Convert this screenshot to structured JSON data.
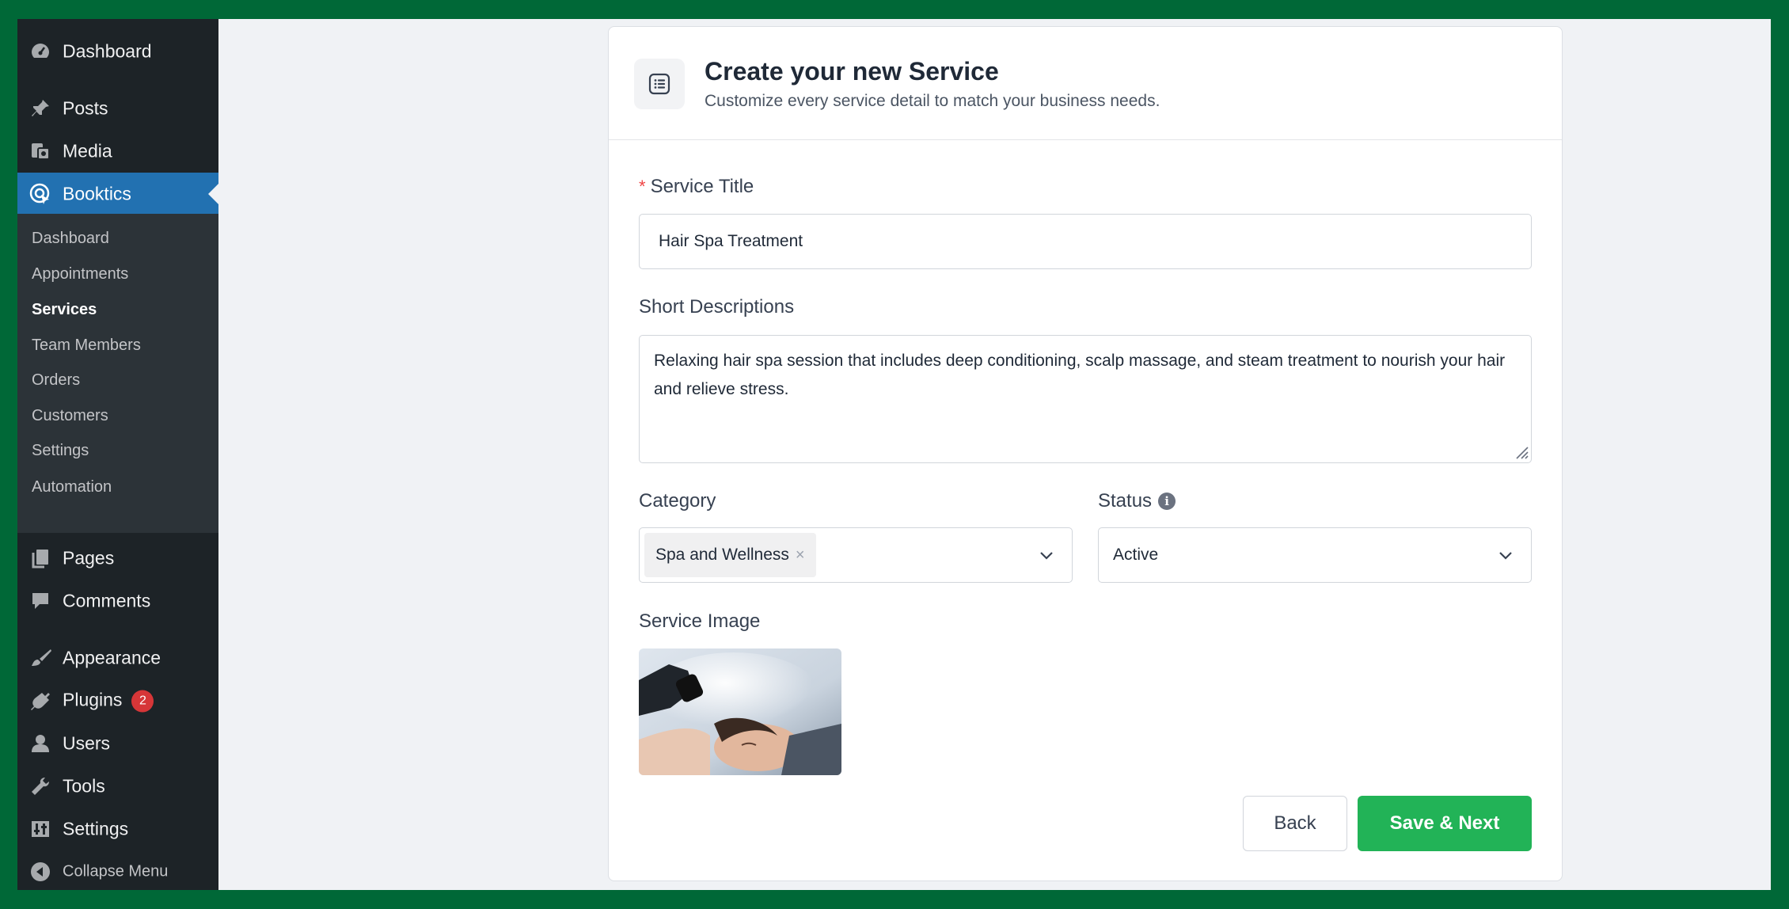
{
  "sidebar": {
    "top_items": [
      {
        "label": "Dashboard",
        "icon": "dashboard-icon"
      },
      {
        "label": "Posts",
        "icon": "pin-icon"
      },
      {
        "label": "Media",
        "icon": "media-icon"
      },
      {
        "label": "Booktics",
        "icon": "booktics-icon"
      }
    ],
    "submenu": [
      "Dashboard",
      "Appointments",
      "Services",
      "Team Members",
      "Orders",
      "Customers",
      "Settings",
      "Automation"
    ],
    "bottom_items": [
      {
        "label": "Pages",
        "icon": "pages-icon"
      },
      {
        "label": "Comments",
        "icon": "comments-icon"
      },
      {
        "label": "Appearance",
        "icon": "brush-icon"
      },
      {
        "label": "Plugins",
        "icon": "plugin-icon",
        "badge": "2"
      },
      {
        "label": "Users",
        "icon": "user-icon"
      },
      {
        "label": "Tools",
        "icon": "wrench-icon"
      },
      {
        "label": "Settings",
        "icon": "settings-icon"
      }
    ],
    "collapse_label": "Collapse Menu"
  },
  "card": {
    "title": "Create your new Service",
    "subtitle": "Customize every service detail to match your business needs."
  },
  "form": {
    "required_mark": "*",
    "title_label": "Service Title",
    "title_value": "Hair Spa Treatment",
    "desc_label": "Short Descriptions",
    "desc_value": "Relaxing hair spa session that includes deep conditioning, scalp massage, and steam treatment to nourish your hair and relieve stress.",
    "category_label": "Category",
    "category_tag": "Spa and Wellness",
    "tag_remove": "×",
    "status_label": "Status",
    "status_value": "Active",
    "info_glyph": "i",
    "image_label": "Service Image"
  },
  "buttons": {
    "back": "Back",
    "save_next": "Save & Next"
  },
  "colors": {
    "accent": "#2271b1",
    "primary_button": "#22b357",
    "frame": "#006837"
  }
}
